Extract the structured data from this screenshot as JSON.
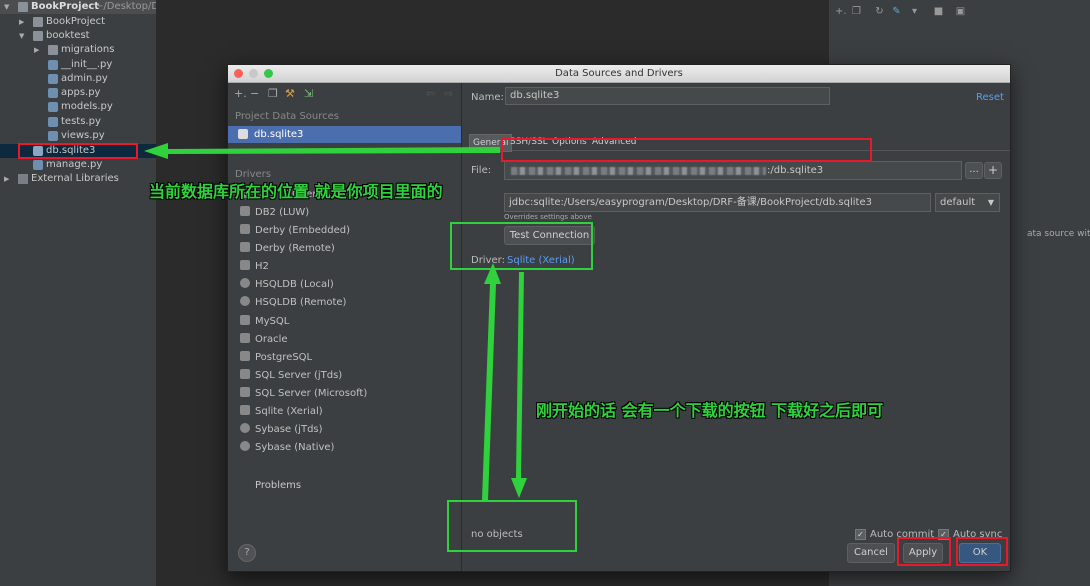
{
  "tree": {
    "project_name": "BookProject",
    "project_path": "~/Desktop/D",
    "items": [
      {
        "label": "BookProject",
        "type": "folder"
      },
      {
        "label": "booktest",
        "type": "folder"
      },
      {
        "label": "migrations",
        "type": "folder"
      },
      {
        "label": "__init__.py",
        "type": "py"
      },
      {
        "label": "admin.py",
        "type": "py"
      },
      {
        "label": "apps.py",
        "type": "py"
      },
      {
        "label": "models.py",
        "type": "py"
      },
      {
        "label": "tests.py",
        "type": "py"
      },
      {
        "label": "views.py",
        "type": "py"
      },
      {
        "label": "db.sqlite3",
        "type": "db"
      },
      {
        "label": "manage.py",
        "type": "py"
      },
      {
        "label": "External Libraries",
        "type": "lib"
      }
    ]
  },
  "right_pane": {
    "hint_text": "ata source with ⌘"
  },
  "dialog": {
    "title": "Data Sources and Drivers",
    "left": {
      "project_sources_header": "Project Data Sources",
      "selected_source": "db.sqlite3",
      "drivers_header": "Drivers",
      "drivers": [
        "DB2 (JTOpen)",
        "DB2 (LUW)",
        "Derby (Embedded)",
        "Derby (Remote)",
        "H2",
        "HSQLDB (Local)",
        "HSQLDB (Remote)",
        "MySQL",
        "Oracle",
        "PostgreSQL",
        "SQL Server (jTds)",
        "SQL Server (Microsoft)",
        "Sqlite (Xerial)",
        "Sybase (jTds)",
        "Sybase (Native)"
      ],
      "problems_label": "Problems",
      "help_label": "?"
    },
    "right": {
      "name_label": "Name:",
      "name_value": "db.sqlite3",
      "reset_label": "Reset",
      "tabs": [
        "General",
        "SSH/SSL",
        "Options",
        "Advanced"
      ],
      "file_label": "File:",
      "file_value": ":/db.sqlite3",
      "file_browse": "...",
      "file_add": "+",
      "url_value": "jdbc:sqlite:/Users/easyprogram/Desktop/DRF-备课/BookProject/db.sqlite3",
      "url_hint": "Overrides settings above",
      "url_mode": "default",
      "test_connection": "Test Connection",
      "driver_label": "Driver:",
      "driver_value": "Sqlite (Xerial)",
      "objects_text": "no objects",
      "auto_commit": "Auto commit",
      "auto_sync": "Auto sync"
    },
    "buttons": {
      "cancel": "Cancel",
      "apply": "Apply",
      "ok": "OK"
    }
  },
  "annotations": {
    "location_note": "当前数据库所在的位置 就是你项目里面的",
    "download_note": "刚开始的话 会有一个下载的按钮 下载好之后即可"
  },
  "colors": {
    "accent": "#4b6eaf",
    "annotation_green": "#2fd23d",
    "annotation_red": "#e8192c",
    "link": "#589df6"
  }
}
